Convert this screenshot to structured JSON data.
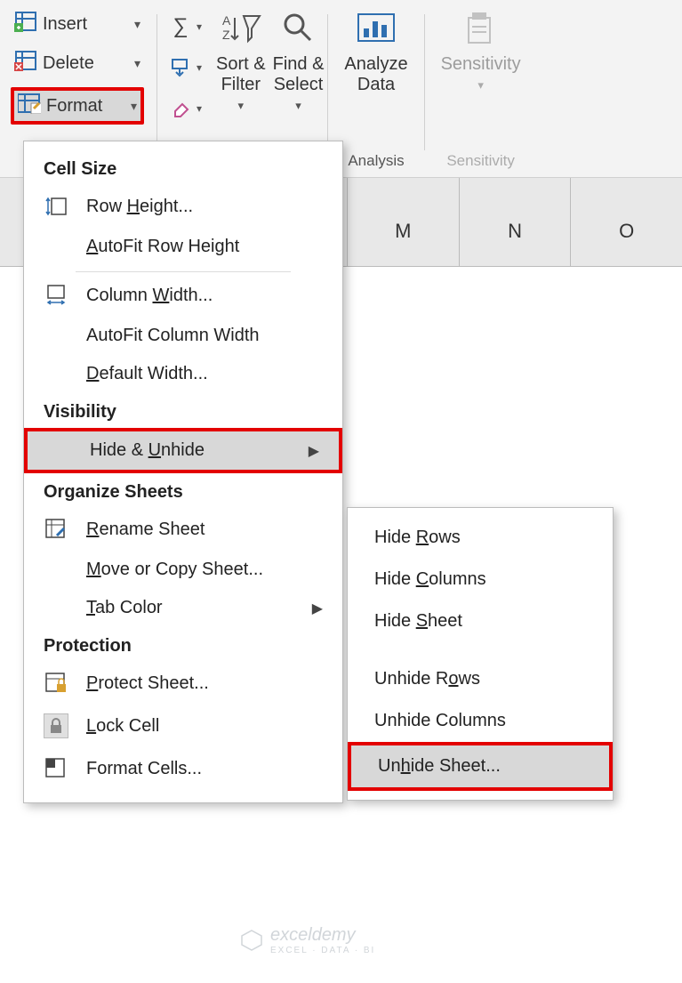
{
  "ribbon": {
    "cells": {
      "insert": "Insert",
      "delete": "Delete",
      "format": "Format"
    },
    "editing": {
      "sort_filter": "Sort &\nFilter",
      "find_select": "Find &\nSelect"
    },
    "analysis": {
      "analyze_data": "Analyze\nData",
      "group_label": "Analysis"
    },
    "sensitivity": {
      "btn": "Sensitivity",
      "group_label": "Sensitivity"
    }
  },
  "columns": {
    "m": "M",
    "n": "N",
    "o": "O"
  },
  "menu": {
    "headers": {
      "cell_size": "Cell Size",
      "visibility": "Visibility",
      "organize": "Organize Sheets",
      "protection": "Protection"
    },
    "items": {
      "row_height": {
        "pre": "Row ",
        "u": "H",
        "post": "eight..."
      },
      "autofit_row": {
        "pre": "",
        "u": "A",
        "post": "utoFit Row Height"
      },
      "col_width": {
        "pre": "Column ",
        "u": "W",
        "post": "idth..."
      },
      "autofit_col": {
        "txt": "AutoFit Column Width"
      },
      "default_width": {
        "pre": "",
        "u": "D",
        "post": "efault Width..."
      },
      "hide_unhide": {
        "pre": "Hide & ",
        "u": "U",
        "post": "nhide"
      },
      "rename": {
        "pre": "",
        "u": "R",
        "post": "ename Sheet"
      },
      "move_copy": {
        "pre": "",
        "u": "M",
        "post": "ove or Copy Sheet..."
      },
      "tab_color": {
        "pre": "",
        "u": "T",
        "post": "ab Color"
      },
      "protect": {
        "pre": "",
        "u": "P",
        "post": "rotect Sheet..."
      },
      "lock": {
        "pre": "",
        "u": "L",
        "post": "ock Cell"
      },
      "format_cells": {
        "txt": "Format Cells..."
      }
    }
  },
  "submenu": {
    "hide_rows": {
      "pre": "Hide ",
      "u": "R",
      "post": "ows"
    },
    "hide_cols": {
      "pre": "Hide ",
      "u": "C",
      "post": "olumns"
    },
    "hide_sheet": {
      "pre": "Hide ",
      "u": "S",
      "post": "heet"
    },
    "unhide_rows": {
      "pre": "Unhide R",
      "u": "o",
      "post": "ws"
    },
    "unhide_cols": {
      "txt": "Unhide Columns"
    },
    "unhide_sheet": {
      "pre": "Un",
      "u": "h",
      "post": "ide Sheet..."
    }
  },
  "watermark": {
    "brand": "exceldemy",
    "sub": "EXCEL · DATA · BI"
  }
}
